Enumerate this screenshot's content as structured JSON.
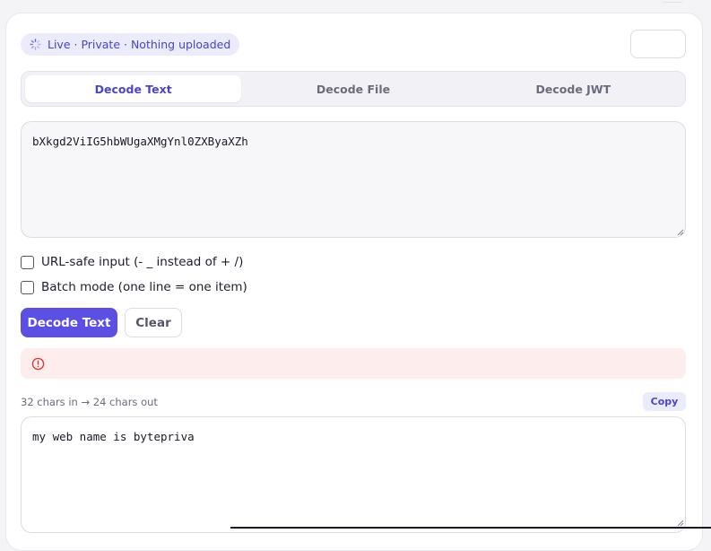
{
  "status": {
    "text": "Live · Private · Nothing uploaded",
    "icon": "spinner-icon"
  },
  "tabs": [
    {
      "label": "Decode Text",
      "active": true
    },
    {
      "label": "Decode File",
      "active": false
    },
    {
      "label": "Decode JWT",
      "active": false
    }
  ],
  "input": {
    "value": "bXkgd2ViIG5hbWUgaXMgYnl0ZXByaXZh"
  },
  "options": {
    "url_safe_label": "URL-safe input (- _ instead of + /)",
    "batch_label": "Batch mode (one line = one item)"
  },
  "actions": {
    "decode_label": "Decode Text",
    "clear_label": "Clear"
  },
  "error": {
    "icon": "alert-circle-icon"
  },
  "result": {
    "stats": "32 chars in → 24 chars out",
    "copy_label": "Copy",
    "output": "my web name is bytepriva"
  },
  "colors": {
    "accent": "#5b50e3",
    "accent_text": "#4b45c9",
    "error_bg": "#fdeeed",
    "error_icon": "#d93b3b"
  }
}
